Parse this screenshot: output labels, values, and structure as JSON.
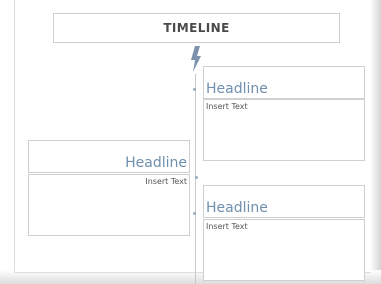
{
  "title": "TIMELINE",
  "events": [
    {
      "headline": "Headline",
      "text": "Insert Text",
      "side": "right"
    },
    {
      "headline": "Headline",
      "text": "Insert Text",
      "side": "left"
    },
    {
      "headline": "Headline",
      "text": "Insert Text",
      "side": "right"
    }
  ],
  "colors": {
    "headline": "#6f8fae",
    "accent": "#7d93ad",
    "border": "#cfcfcf"
  },
  "icons": {
    "connector": "lightning-bolt-icon"
  }
}
